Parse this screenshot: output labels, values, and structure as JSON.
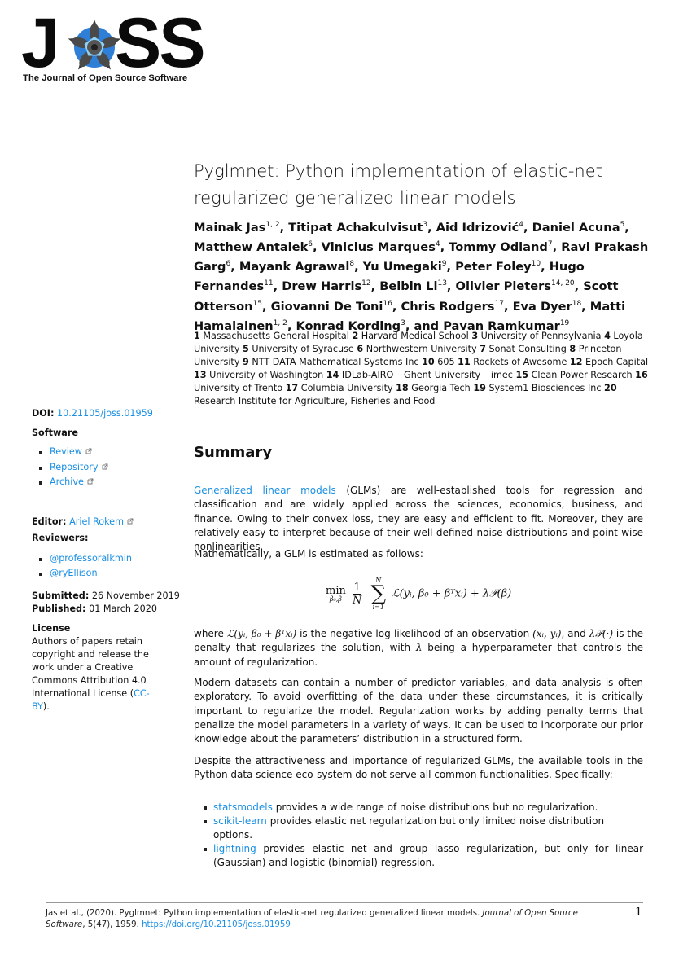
{
  "logo": {
    "letters_left": "J",
    "letters_right": "SS",
    "tagline": "The Journal of Open Source Software",
    "colors": {
      "blue": "#2f7fd6",
      "dark": "#2b2b2b"
    }
  },
  "paper": {
    "title": "Pyglmnet: Python implementation of elastic-net regularized generalized linear models",
    "authors": [
      {
        "name": "Mainak Jas",
        "aff": "1, 2"
      },
      {
        "name": "Titipat Achakulvisut",
        "aff": "3"
      },
      {
        "name": "Aid Idrizović",
        "aff": "4"
      },
      {
        "name": "Daniel Acuna",
        "aff": "5"
      },
      {
        "name": "Matthew Antalek",
        "aff": "6"
      },
      {
        "name": "Vinicius Marques",
        "aff": "4"
      },
      {
        "name": "Tommy Odland",
        "aff": "7"
      },
      {
        "name": "Ravi Prakash Garg",
        "aff": "6"
      },
      {
        "name": "Mayank Agrawal",
        "aff": "8"
      },
      {
        "name": "Yu Umegaki",
        "aff": "9"
      },
      {
        "name": "Peter Foley",
        "aff": "10"
      },
      {
        "name": "Hugo Fernandes",
        "aff": "11"
      },
      {
        "name": "Drew Harris",
        "aff": "12"
      },
      {
        "name": "Beibin Li",
        "aff": "13"
      },
      {
        "name": "Olivier Pieters",
        "aff": "14, 20"
      },
      {
        "name": "Scott Otterson",
        "aff": "15"
      },
      {
        "name": "Giovanni De Toni",
        "aff": "16"
      },
      {
        "name": "Chris Rodgers",
        "aff": "17"
      },
      {
        "name": "Eva Dyer",
        "aff": "18"
      },
      {
        "name": "Matti Hamalainen",
        "aff": "1, 2"
      },
      {
        "name": "Konrad Kording",
        "aff": "3"
      },
      {
        "name": "Pavan Ramkumar",
        "aff": "19"
      }
    ],
    "last_author_joiner": "and",
    "affiliations": [
      {
        "n": "1",
        "name": "Massachusetts General Hospital"
      },
      {
        "n": "2",
        "name": "Harvard Medical School"
      },
      {
        "n": "3",
        "name": "University of Pennsylvania"
      },
      {
        "n": "4",
        "name": "Loyola University"
      },
      {
        "n": "5",
        "name": "University of Syracuse"
      },
      {
        "n": "6",
        "name": "Northwestern University"
      },
      {
        "n": "7",
        "name": "Sonat Consulting"
      },
      {
        "n": "8",
        "name": "Princeton University"
      },
      {
        "n": "9",
        "name": "NTT DATA Mathematical Systems Inc"
      },
      {
        "n": "10",
        "name": "605"
      },
      {
        "n": "11",
        "name": "Rockets of Awesome"
      },
      {
        "n": "12",
        "name": "Epoch Capital"
      },
      {
        "n": "13",
        "name": "University of Washington"
      },
      {
        "n": "14",
        "name": "IDLab-AIRO – Ghent University – imec"
      },
      {
        "n": "15",
        "name": "Clean Power Research"
      },
      {
        "n": "16",
        "name": "University of Trento"
      },
      {
        "n": "17",
        "name": "Columbia University"
      },
      {
        "n": "18",
        "name": "Georgia Tech"
      },
      {
        "n": "19",
        "name": "System1 Biosciences Inc"
      },
      {
        "n": "20",
        "name": "Research Institute for Agriculture, Fisheries and Food"
      }
    ]
  },
  "sidebar": {
    "doi_label": "DOI:",
    "doi_value": "10.21105/joss.01959",
    "software_label": "Software",
    "software_links": [
      "Review",
      "Repository",
      "Archive"
    ],
    "editor_label": "Editor:",
    "editor_name": "Ariel Rokem",
    "reviewers_label": "Reviewers:",
    "reviewers": [
      "@professoralkmin",
      "@ryEllison"
    ],
    "submitted_label": "Submitted:",
    "submitted_date": "26 November 2019",
    "published_label": "Published:",
    "published_date": "01 March 2020",
    "license_label": "License",
    "license_text": "Authors of papers retain copyright and release the work under a Creative Commons Attribution 4.0 International License (",
    "license_link": "CC-BY",
    "license_end": ")."
  },
  "summary": {
    "heading": "Summary",
    "p1_link": "Generalized linear models",
    "p1_text": " (GLMs) are well-established tools for regression and classification and are widely applied across the sciences, economics, business, and finance. Owing to their convex loss, they are easy and efficient to fit. Moreover, they are relatively easy to interpret because of their well-defined noise distributions and point-wise nonlinearities.",
    "p2": "Mathematically, a GLM is estimated as follows:",
    "equation": {
      "min": "min",
      "min_sub": "β₀,β",
      "frac_num": "1",
      "frac_den": "N",
      "sum_top": "N",
      "sum_bottom": "i=1",
      "body": "ℒ(yᵢ, β₀ + βᵀxᵢ) + λ𝒫(β)"
    },
    "p3_a": "where ",
    "p3_m1": "ℒ(yᵢ, β₀ + βᵀxᵢ)",
    "p3_b": " is the negative log-likelihood of an observation ",
    "p3_m2": "(xᵢ, yᵢ)",
    "p3_c": ", and ",
    "p3_m3": "λ𝒫(·)",
    "p3_d": " is the penalty that regularizes the solution, with ",
    "p3_m4": "λ",
    "p3_e": " being a hyperparameter that controls the amount of regularization.",
    "p4": "Modern datasets can contain a number of predictor variables, and data analysis is often exploratory. To avoid overfitting of the data under these circumstances, it is critically important to regularize the model. Regularization works by adding penalty terms that penalize the model parameters in a variety of ways. It can be used to incorporate our prior knowledge about the parameters’ distribution in a structured form.",
    "p5": "Despite the attractiveness and importance of regularized GLMs, the available tools in the Python data science eco-system do not serve all common functionalities. Specifically:",
    "bullets": [
      {
        "link": "statsmodels",
        "text": " provides a wide range of noise distributions but no regularization."
      },
      {
        "link": "scikit-learn",
        "text": " provides elastic net regularization but only limited noise distribution options."
      },
      {
        "link": "lightning",
        "text": " provides elastic net and group lasso regularization, but only for linear (Gaussian) and logistic (binomial) regression."
      }
    ]
  },
  "footer": {
    "citation": "Jas et al., (2020). Pyglmnet: Python implementation of elastic-net regularized generalized linear models. ",
    "journal": "Journal of Open Source Software",
    "volume": ", 5(47), 1959. ",
    "doi_url": "https://doi.org/10.21105/joss.01959",
    "page_number": "1"
  }
}
